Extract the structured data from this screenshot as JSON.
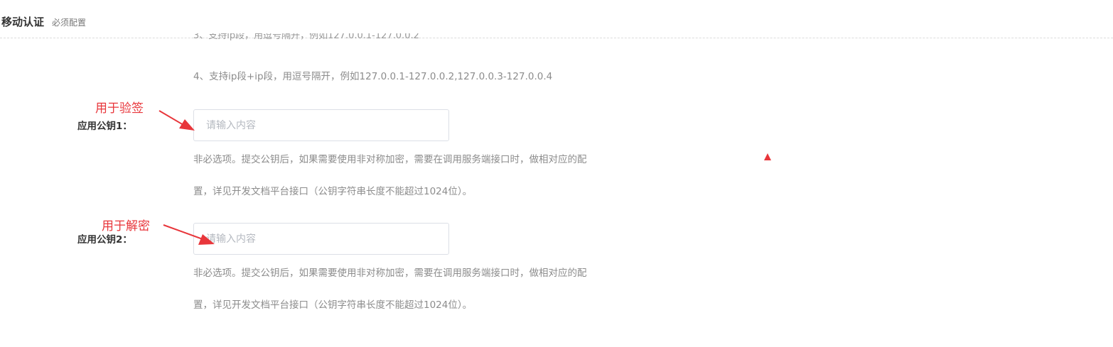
{
  "header": {
    "title": "移动认证",
    "subtitle": "必须配置"
  },
  "ip_rules": {
    "cut_line": "3、支持ip段，用逗号隔开，例如127.0.0.1-127.0.0.2",
    "rule_4": "4、支持ip段+ip段，用逗号隔开，例如127.0.0.1-127.0.0.2,127.0.0.3-127.0.0.4"
  },
  "fields": [
    {
      "label": "应用公钥1：",
      "placeholder": "请输入内容",
      "value": "",
      "help_line1": "非必选项。提交公钥后，如果需要使用非对称加密，需要在调用服务端接口时，做相对应的配",
      "help_line2": "置，详见开发文档平台接口（公钥字符串长度不能超过1024位）。",
      "annotation": "用于验签"
    },
    {
      "label": "应用公钥2：",
      "placeholder": "请输入内容",
      "value": "",
      "help_line1": "非必选项。提交公钥后，如果需要使用非对称加密，需要在调用服务端接口时，做相对应的配",
      "help_line2": "置，详见开发文档平台接口（公钥字符串长度不能超过1024位）。",
      "annotation": "用于解密"
    }
  ],
  "colors": {
    "annotation": "#e8363b",
    "help_text": "#8c8c8c",
    "input_border": "#dcdfe6"
  }
}
